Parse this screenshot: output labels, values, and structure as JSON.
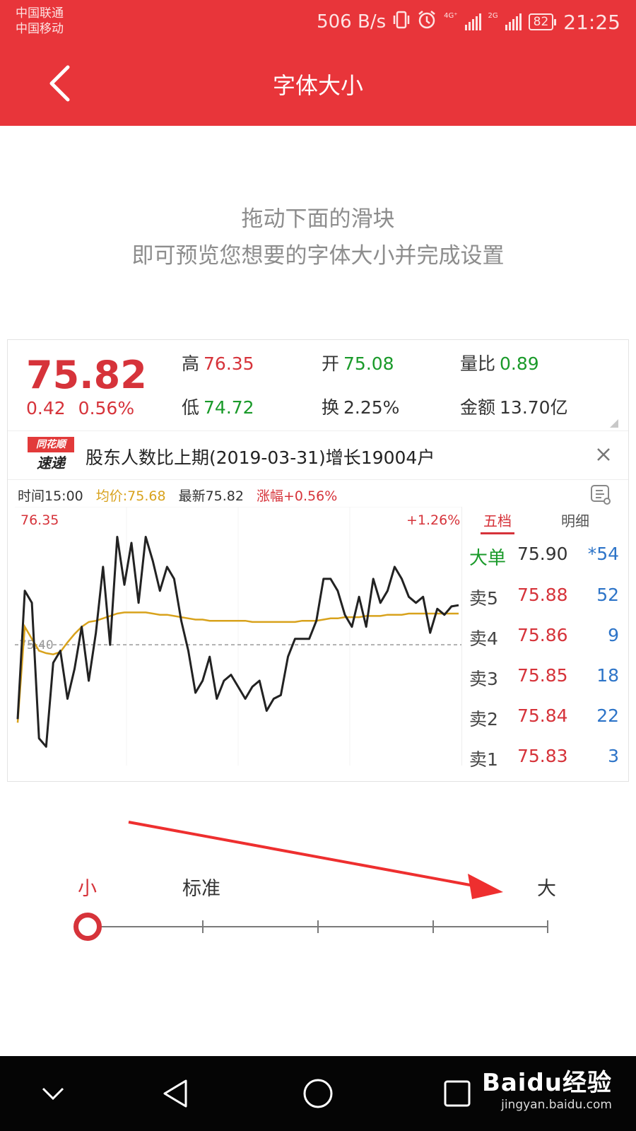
{
  "status_bar": {
    "carrier1": "中国联通",
    "carrier2": "中国移动",
    "speed": "506 B/s",
    "net1": "4G⁺",
    "net2": "2G",
    "battery": "82",
    "time": "21:25"
  },
  "app_bar": {
    "title": "字体大小"
  },
  "instructions": {
    "line1": "拖动下面的滑块",
    "line2": "即可预览您想要的字体大小并完成设置"
  },
  "quote": {
    "price": "75.82",
    "change": "0.42",
    "change_pct": "0.56%",
    "high_label": "高",
    "high": "76.35",
    "low_label": "低",
    "low": "74.72",
    "open_label": "开",
    "open": "75.08",
    "turnover_label": "换",
    "turnover": "2.25%",
    "volratio_label": "量比",
    "volratio": "0.89",
    "amount_label": "金额",
    "amount": "13.70亿"
  },
  "news": {
    "logo_top": "同花顺",
    "logo_bottom": "速递",
    "text": "股东人数比上期(2019-03-31)增长19004户"
  },
  "chart_header": {
    "time": "时间15:00",
    "avg": "均价:75.68",
    "latest": "最新75.82",
    "change": "涨幅+0.56%"
  },
  "chart_data": {
    "type": "line",
    "ylim": [
      74.44,
      76.35
    ],
    "x": [
      0,
      1,
      2,
      3,
      4,
      5,
      6,
      7,
      8,
      9,
      10,
      11,
      12,
      13,
      14,
      15,
      16,
      17,
      18,
      19,
      20,
      21,
      22,
      23,
      24,
      25,
      26,
      27,
      28,
      29,
      30,
      31,
      32,
      33,
      34,
      35,
      36,
      37,
      38,
      39,
      40,
      41,
      42,
      43,
      44,
      45,
      46,
      47,
      48,
      49,
      50,
      51,
      52,
      53,
      54,
      55,
      56,
      57,
      58,
      59,
      60,
      61,
      62
    ],
    "series": [
      {
        "values": [
          74.78,
          75.85,
          75.75,
          74.62,
          74.55,
          75.25,
          75.35,
          74.95,
          75.2,
          75.55,
          75.1,
          75.5,
          76.05,
          75.4,
          76.3,
          75.9,
          76.25,
          75.75,
          76.3,
          76.1,
          75.85,
          76.05,
          75.95,
          75.6,
          75.35,
          75.0,
          75.1,
          75.3,
          74.95,
          75.1,
          75.15,
          75.05,
          74.95,
          75.05,
          75.1,
          74.85,
          74.95,
          74.98,
          75.3,
          75.45,
          75.45,
          75.45,
          75.6,
          75.95,
          75.95,
          75.85,
          75.65,
          75.55,
          75.8,
          75.55,
          75.95,
          75.75,
          75.85,
          76.05,
          75.95,
          75.8,
          75.75,
          75.8,
          75.5,
          75.7,
          75.65,
          75.72,
          75.73
        ]
      },
      {
        "values": [
          74.75,
          75.55,
          75.45,
          75.35,
          75.33,
          75.32,
          75.34,
          75.42,
          75.49,
          75.55,
          75.59,
          75.6,
          75.62,
          75.64,
          75.66,
          75.67,
          75.67,
          75.67,
          75.67,
          75.66,
          75.65,
          75.65,
          75.64,
          75.63,
          75.62,
          75.61,
          75.61,
          75.6,
          75.6,
          75.6,
          75.6,
          75.6,
          75.6,
          75.59,
          75.59,
          75.59,
          75.59,
          75.59,
          75.59,
          75.59,
          75.6,
          75.6,
          75.6,
          75.61,
          75.62,
          75.62,
          75.63,
          75.63,
          75.63,
          75.64,
          75.64,
          75.64,
          75.65,
          75.65,
          75.65,
          75.66,
          75.66,
          75.66,
          75.66,
          75.66,
          75.66,
          75.66,
          75.66
        ]
      }
    ],
    "high_label": "76.35",
    "pct_label": "+1.26%",
    "ref_label": "75.40",
    "ref_value": 75.4
  },
  "orderbook": {
    "tab1": "五档",
    "tab2": "明细",
    "rows": [
      {
        "label": "大单",
        "price": "75.90",
        "qty": "*54"
      },
      {
        "label": "卖5",
        "price": "75.88",
        "qty": "52"
      },
      {
        "label": "卖4",
        "price": "75.86",
        "qty": "9"
      },
      {
        "label": "卖3",
        "price": "75.85",
        "qty": "18"
      },
      {
        "label": "卖2",
        "price": "75.84",
        "qty": "22"
      },
      {
        "label": "卖1",
        "price": "75.83",
        "qty": "3"
      }
    ]
  },
  "slider": {
    "labels": [
      "小",
      "标准",
      "大"
    ],
    "value": 0,
    "steps": 5
  },
  "watermark": {
    "brand": "Baidu经验",
    "url": "jingyan.baidu.com"
  },
  "colors": {
    "primary": "#e8353a",
    "up": "#d6333a",
    "down": "#1a9a2a",
    "avg_line": "#d8a21c",
    "qty": "#2d74c8"
  }
}
